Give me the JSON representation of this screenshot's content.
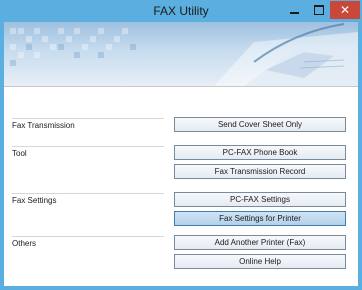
{
  "window": {
    "title": "FAX Utility",
    "minimize_icon": "minimize-icon",
    "maximize_icon": "maximize-icon",
    "close_icon": "close-icon"
  },
  "sections": [
    {
      "label": "Fax Transmission",
      "buttons": [
        "Send Cover Sheet Only"
      ]
    },
    {
      "label": "Tool",
      "buttons": [
        "PC-FAX Phone Book",
        "Fax Transmission Record"
      ]
    },
    {
      "label": "Fax Settings",
      "buttons": [
        "PC-FAX Settings",
        "Fax Settings for Printer"
      ]
    },
    {
      "label": "Others",
      "buttons": [
        "Add Another Printer (Fax)",
        "Online Help"
      ]
    }
  ],
  "colors": {
    "titlebar": "#5aaee0",
    "close_button": "#c9483a",
    "button_focused": "#b4d1ea"
  }
}
